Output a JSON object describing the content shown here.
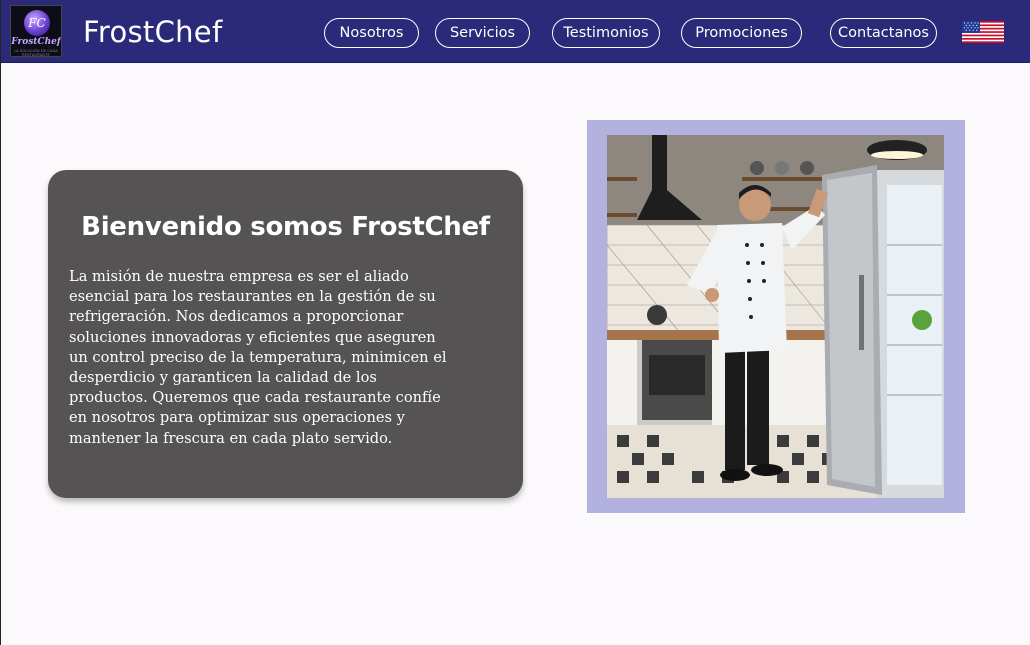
{
  "header": {
    "logo": {
      "monogram": "FC",
      "wordmark": "FrostChef",
      "tagline": "LA SOLUCIÓN DE CADA RESTAURANTE"
    },
    "brand": "FrostChef",
    "nav": [
      {
        "label": "Nosotros"
      },
      {
        "label": "Servicios"
      },
      {
        "label": "Testimonios"
      },
      {
        "label": "Promociones"
      },
      {
        "label": "Contactanos"
      }
    ],
    "language_flag": "us-flag-icon"
  },
  "hero": {
    "title": "Bienvenido somos FrostChef",
    "body_lines": [
      "La misión de nuestra empresa es ser el aliado",
      "esencial para los restaurantes en la gestión de su",
      "refrigeración. Nos dedicamos a proporcionar",
      "soluciones innovadoras y eficientes que aseguren",
      "un control preciso de la temperatura, minimicen el",
      "desperdicio y garanticen la calidad de los",
      "productos. Queremos que cada restaurante confíe",
      "en nosotros para optimizar sus operaciones y",
      "mantener la frescura en cada plato servido."
    ]
  },
  "colors": {
    "navbar": "#2b2a7a",
    "card": "#555354",
    "frame": "#b3b1de",
    "page": "#fbf9fb"
  }
}
